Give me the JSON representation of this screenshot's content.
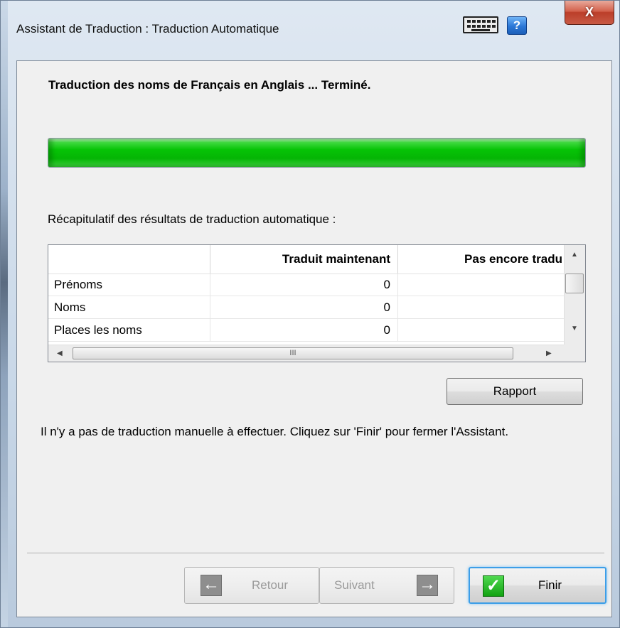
{
  "window": {
    "title": "Assistant de Traduction : Traduction Automatique",
    "help_label": "?",
    "close_label": "X"
  },
  "main": {
    "heading": "Traduction des noms de Français en Anglais ... Terminé.",
    "progress_percent": 100,
    "progress_color": "#06c306",
    "summary_label": "Récapitulatif des résultats de traduction automatique :",
    "table": {
      "columns": [
        "",
        "Traduit maintenant",
        "Pas encore tradu"
      ],
      "rows": [
        {
          "name": "Prénoms",
          "translated": "0",
          "pending": ""
        },
        {
          "name": "Noms",
          "translated": "0",
          "pending": ""
        },
        {
          "name": "Places les noms",
          "translated": "0",
          "pending": ""
        }
      ],
      "hscroll_grip": "III"
    },
    "report_button": "Rapport",
    "message": "Il n'y a pas de traduction manuelle à effectuer. Cliquez sur 'Finir' pour fermer l'Assistant."
  },
  "footer": {
    "back_label": "Retour",
    "next_label": "Suivant",
    "finish_label": "Finir",
    "back_icon": "arrow-left-icon",
    "next_icon": "arrow-right-icon",
    "finish_icon": "check-icon"
  }
}
